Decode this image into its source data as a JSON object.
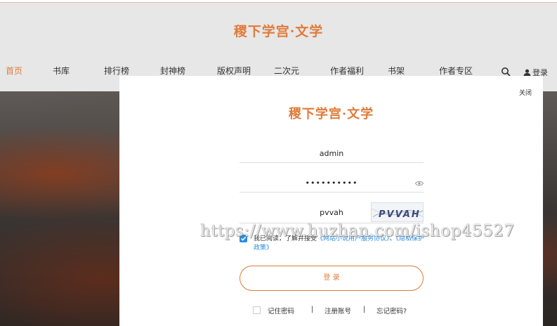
{
  "site": {
    "logo_text": "稷下学宫·文学",
    "accent_color": "#e07b39"
  },
  "nav": {
    "items": [
      {
        "label": "首页",
        "active": true
      },
      {
        "label": "书库",
        "active": false
      },
      {
        "label": "排行榜",
        "active": false
      },
      {
        "label": "封神榜",
        "active": false
      },
      {
        "label": "版权声明",
        "active": false
      },
      {
        "label": "二次元",
        "active": false
      },
      {
        "label": "作者福利",
        "active": false
      },
      {
        "label": "书架",
        "active": false
      },
      {
        "label": "作者专区",
        "active": false
      }
    ],
    "search_icon": "search-icon",
    "login_label": "登录",
    "user_icon": "user-icon"
  },
  "modal": {
    "close_label": "关闭",
    "logo_text": "稷下学宫·文学",
    "username_value": "admin",
    "password_value": "••••••••••",
    "eye_icon": "eye-icon",
    "captcha_value": "pvvah",
    "captcha_image_text": "PVVAH",
    "agree_prefix": "我已阅读，了解并接受",
    "agree_link_1": "《网站小说用户服务协议》",
    "agree_sep": "、",
    "agree_link_2": "《隐私保护政策》",
    "login_button": "登 录",
    "remember_label": "记住密码",
    "divider": "|",
    "register_label": "注册账号",
    "forgot_label": "忘记密码?",
    "link_color": "#2b8de0"
  },
  "watermark": "https://www.huzhan.com/ishop45527"
}
